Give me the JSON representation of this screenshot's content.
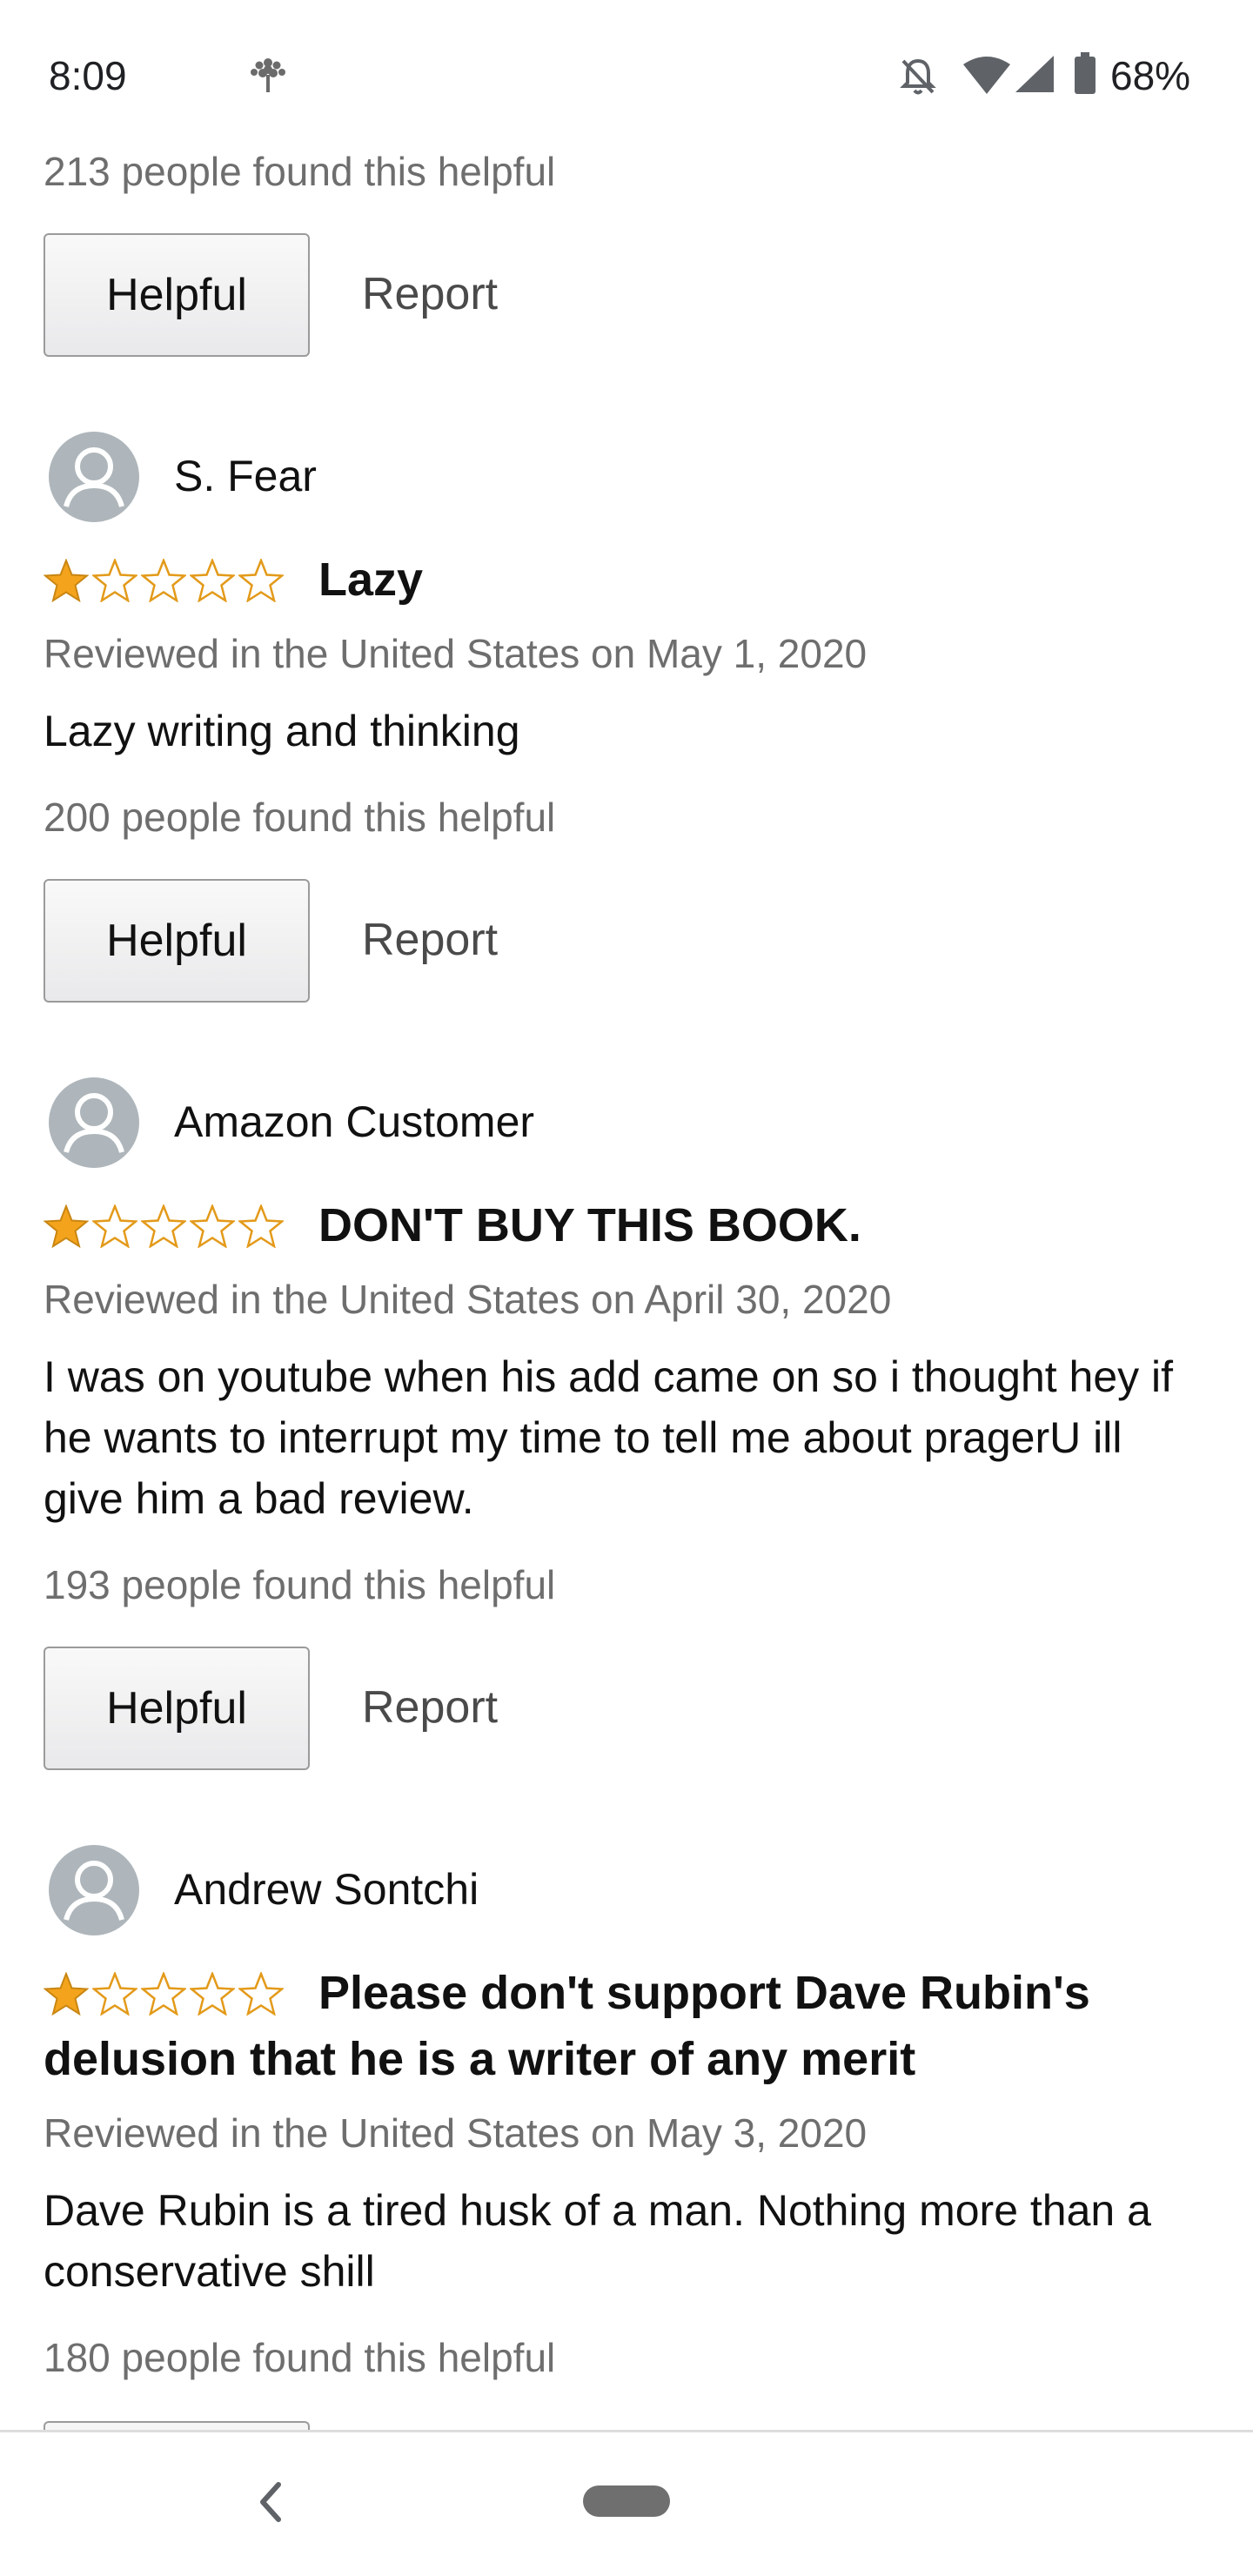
{
  "status_bar": {
    "time": "8:09",
    "battery": "68%"
  },
  "top_review_tail": {
    "helpful_count": "213 people found this helpful",
    "helpful_label": "Helpful",
    "report_label": "Report"
  },
  "reviews": [
    {
      "name": "S. Fear",
      "rating": 1,
      "title": "Lazy",
      "date": "Reviewed in the United States on May 1, 2020",
      "body": "Lazy writing and thinking",
      "helpful_count": "200 people found this helpful",
      "helpful_label": "Helpful",
      "report_label": "Report"
    },
    {
      "name": "Amazon Customer",
      "rating": 1,
      "title": "DON'T BUY THIS BOOK.",
      "date": "Reviewed in the United States on April 30, 2020",
      "body": "I was on youtube when his add came on so i thought hey if he wants to interrupt my time to tell me about pragerU ill give him a bad review.",
      "helpful_count": "193 people found this helpful",
      "helpful_label": "Helpful",
      "report_label": "Report"
    },
    {
      "name": "Andrew Sontchi",
      "rating": 1,
      "title": "Please don't support Dave Rubin's delusion that he is a writer of any merit",
      "date": "Reviewed in the United States on May 3, 2020",
      "body": "Dave Rubin is a tired husk of a man. Nothing more than a conservative shill",
      "helpful_count": "180 people found this helpful"
    }
  ],
  "colors": {
    "star_fill": "#f4a41c",
    "star_outline": "#e39a1a",
    "secondary_text": "#6e6e6e",
    "button_border": "#9b9b9b"
  },
  "icons": [
    "tree-icon",
    "notifications-off-icon",
    "wifi-icon",
    "cell-signal-icon",
    "battery-icon",
    "avatar-icon",
    "star-icon",
    "back-chevron-icon"
  ]
}
